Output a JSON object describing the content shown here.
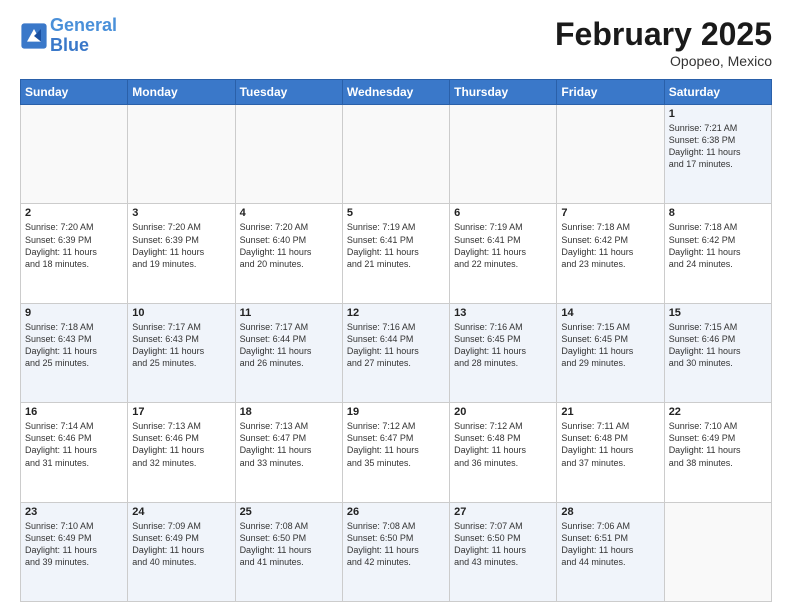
{
  "header": {
    "logo_line1": "General",
    "logo_line2": "Blue",
    "month_title": "February 2025",
    "location": "Opopeo, Mexico"
  },
  "weekdays": [
    "Sunday",
    "Monday",
    "Tuesday",
    "Wednesday",
    "Thursday",
    "Friday",
    "Saturday"
  ],
  "weeks": [
    [
      {
        "day": "",
        "info": ""
      },
      {
        "day": "",
        "info": ""
      },
      {
        "day": "",
        "info": ""
      },
      {
        "day": "",
        "info": ""
      },
      {
        "day": "",
        "info": ""
      },
      {
        "day": "",
        "info": ""
      },
      {
        "day": "1",
        "info": "Sunrise: 7:21 AM\nSunset: 6:38 PM\nDaylight: 11 hours\nand 17 minutes."
      }
    ],
    [
      {
        "day": "2",
        "info": "Sunrise: 7:20 AM\nSunset: 6:39 PM\nDaylight: 11 hours\nand 18 minutes."
      },
      {
        "day": "3",
        "info": "Sunrise: 7:20 AM\nSunset: 6:39 PM\nDaylight: 11 hours\nand 19 minutes."
      },
      {
        "day": "4",
        "info": "Sunrise: 7:20 AM\nSunset: 6:40 PM\nDaylight: 11 hours\nand 20 minutes."
      },
      {
        "day": "5",
        "info": "Sunrise: 7:19 AM\nSunset: 6:41 PM\nDaylight: 11 hours\nand 21 minutes."
      },
      {
        "day": "6",
        "info": "Sunrise: 7:19 AM\nSunset: 6:41 PM\nDaylight: 11 hours\nand 22 minutes."
      },
      {
        "day": "7",
        "info": "Sunrise: 7:18 AM\nSunset: 6:42 PM\nDaylight: 11 hours\nand 23 minutes."
      },
      {
        "day": "8",
        "info": "Sunrise: 7:18 AM\nSunset: 6:42 PM\nDaylight: 11 hours\nand 24 minutes."
      }
    ],
    [
      {
        "day": "9",
        "info": "Sunrise: 7:18 AM\nSunset: 6:43 PM\nDaylight: 11 hours\nand 25 minutes."
      },
      {
        "day": "10",
        "info": "Sunrise: 7:17 AM\nSunset: 6:43 PM\nDaylight: 11 hours\nand 25 minutes."
      },
      {
        "day": "11",
        "info": "Sunrise: 7:17 AM\nSunset: 6:44 PM\nDaylight: 11 hours\nand 26 minutes."
      },
      {
        "day": "12",
        "info": "Sunrise: 7:16 AM\nSunset: 6:44 PM\nDaylight: 11 hours\nand 27 minutes."
      },
      {
        "day": "13",
        "info": "Sunrise: 7:16 AM\nSunset: 6:45 PM\nDaylight: 11 hours\nand 28 minutes."
      },
      {
        "day": "14",
        "info": "Sunrise: 7:15 AM\nSunset: 6:45 PM\nDaylight: 11 hours\nand 29 minutes."
      },
      {
        "day": "15",
        "info": "Sunrise: 7:15 AM\nSunset: 6:46 PM\nDaylight: 11 hours\nand 30 minutes."
      }
    ],
    [
      {
        "day": "16",
        "info": "Sunrise: 7:14 AM\nSunset: 6:46 PM\nDaylight: 11 hours\nand 31 minutes."
      },
      {
        "day": "17",
        "info": "Sunrise: 7:13 AM\nSunset: 6:46 PM\nDaylight: 11 hours\nand 32 minutes."
      },
      {
        "day": "18",
        "info": "Sunrise: 7:13 AM\nSunset: 6:47 PM\nDaylight: 11 hours\nand 33 minutes."
      },
      {
        "day": "19",
        "info": "Sunrise: 7:12 AM\nSunset: 6:47 PM\nDaylight: 11 hours\nand 35 minutes."
      },
      {
        "day": "20",
        "info": "Sunrise: 7:12 AM\nSunset: 6:48 PM\nDaylight: 11 hours\nand 36 minutes."
      },
      {
        "day": "21",
        "info": "Sunrise: 7:11 AM\nSunset: 6:48 PM\nDaylight: 11 hours\nand 37 minutes."
      },
      {
        "day": "22",
        "info": "Sunrise: 7:10 AM\nSunset: 6:49 PM\nDaylight: 11 hours\nand 38 minutes."
      }
    ],
    [
      {
        "day": "23",
        "info": "Sunrise: 7:10 AM\nSunset: 6:49 PM\nDaylight: 11 hours\nand 39 minutes."
      },
      {
        "day": "24",
        "info": "Sunrise: 7:09 AM\nSunset: 6:49 PM\nDaylight: 11 hours\nand 40 minutes."
      },
      {
        "day": "25",
        "info": "Sunrise: 7:08 AM\nSunset: 6:50 PM\nDaylight: 11 hours\nand 41 minutes."
      },
      {
        "day": "26",
        "info": "Sunrise: 7:08 AM\nSunset: 6:50 PM\nDaylight: 11 hours\nand 42 minutes."
      },
      {
        "day": "27",
        "info": "Sunrise: 7:07 AM\nSunset: 6:50 PM\nDaylight: 11 hours\nand 43 minutes."
      },
      {
        "day": "28",
        "info": "Sunrise: 7:06 AM\nSunset: 6:51 PM\nDaylight: 11 hours\nand 44 minutes."
      },
      {
        "day": "",
        "info": ""
      }
    ]
  ]
}
